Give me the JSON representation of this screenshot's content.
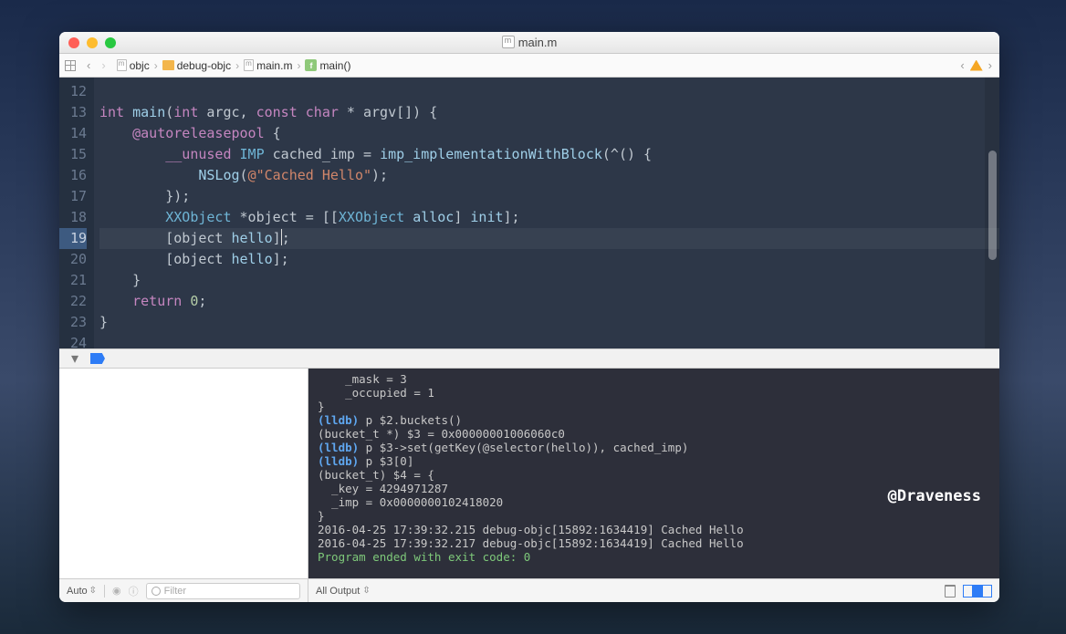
{
  "title": "main.m",
  "breadcrumb": [
    "objc",
    "debug-objc",
    "main.m",
    "main()"
  ],
  "jump_warning": true,
  "editor": {
    "first_line": 12,
    "current_line": 19,
    "lines": [
      "",
      "int main(int argc, const char * argv[]) {",
      "    @autoreleasepool {",
      "        __unused IMP cached_imp = imp_implementationWithBlock(^() {",
      "            NSLog(@\"Cached Hello\");",
      "        });",
      "        XXObject *object = [[XXObject alloc] init];",
      "        [object hello];",
      "        [object hello];",
      "    }",
      "    return 0;",
      "}",
      ""
    ]
  },
  "console": [
    "    _mask = 3",
    "    _occupied = 1",
    "}",
    "(lldb) p $2.buckets()",
    "(bucket_t *) $3 = 0x00000001006060c0",
    "(lldb) p $3->set(getKey(@selector(hello)), cached_imp)",
    "(lldb) p $3[0]",
    "(bucket_t) $4 = {",
    "  _key = 4294971287",
    "  _imp = 0x0000000102418020",
    "}",
    "2016-04-25 17:39:32.215 debug-objc[15892:1634419] Cached Hello",
    "2016-04-25 17:39:32.217 debug-objc[15892:1634419] Cached Hello",
    "Program ended with exit code: 0"
  ],
  "watermark": "@Draveness",
  "bottombar": {
    "auto": "Auto",
    "filter_placeholder": "Filter",
    "all_output": "All Output"
  }
}
